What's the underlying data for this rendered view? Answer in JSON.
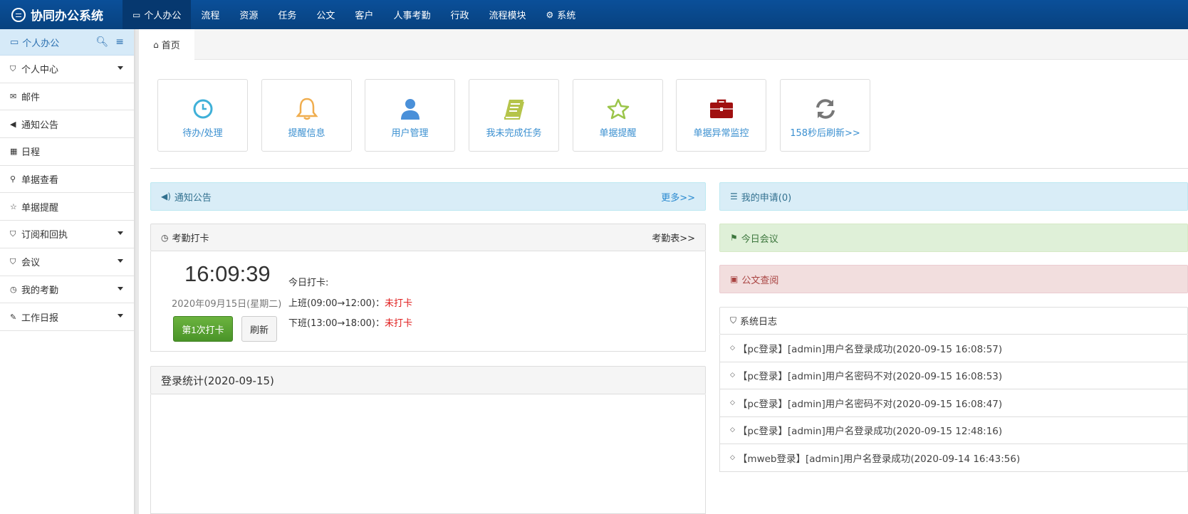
{
  "app": {
    "title": "协同办公系统"
  },
  "nav": [
    {
      "label": "个人办公",
      "icon": "monitor-icon",
      "active": true
    },
    {
      "label": "流程"
    },
    {
      "label": "资源"
    },
    {
      "label": "任务"
    },
    {
      "label": "公文"
    },
    {
      "label": "客户"
    },
    {
      "label": "人事考勤"
    },
    {
      "label": "行政"
    },
    {
      "label": "流程模块"
    },
    {
      "label": "系统",
      "icon": "gear-icon"
    }
  ],
  "sidebar": {
    "title": "个人办公",
    "items": [
      {
        "label": "个人中心",
        "icon": "bookmark-icon",
        "has_children": true
      },
      {
        "label": "邮件",
        "icon": "envelope-icon"
      },
      {
        "label": "通知公告",
        "icon": "volume-icon"
      },
      {
        "label": "日程",
        "icon": "calendar-icon"
      },
      {
        "label": "单据查看",
        "icon": "search-icon"
      },
      {
        "label": "单据提醒",
        "icon": "star-icon"
      },
      {
        "label": "订阅和回执",
        "icon": "bookmark-icon",
        "has_children": true
      },
      {
        "label": "会议",
        "icon": "bookmark-icon",
        "has_children": true
      },
      {
        "label": "我的考勤",
        "icon": "clock-icon",
        "has_children": true
      },
      {
        "label": "工作日报",
        "icon": "edit-icon",
        "has_children": true
      }
    ]
  },
  "tabs": [
    {
      "label": "首页",
      "icon": "home-icon"
    }
  ],
  "tiles": [
    {
      "label": "待办/处理",
      "icon": "clock-icon",
      "color": "#3fb0d8"
    },
    {
      "label": "提醒信息",
      "icon": "bell-icon",
      "color": "#f0ad4e"
    },
    {
      "label": "用户管理",
      "icon": "user-icon",
      "color": "#4a90d9"
    },
    {
      "label": "我未完成任务",
      "icon": "book-icon",
      "color": "#b5c44a"
    },
    {
      "label": "单据提醒",
      "icon": "star-icon",
      "color": "#9bc54a"
    },
    {
      "label": "单据异常监控",
      "icon": "briefcase-icon",
      "color": "#a01010"
    },
    {
      "label": "158秒后刷新>>",
      "icon": "refresh-icon",
      "color": "#777777"
    }
  ],
  "notice_panel": {
    "title": "通知公告",
    "more": "更多>>"
  },
  "attendance_panel": {
    "title": "考勤打卡",
    "more": "考勤表>>",
    "time": "16:09:39",
    "date": "2020年09月15日(星期二)",
    "punch_button": "第1次打卡",
    "refresh_button": "刷新",
    "today_label": "今日打卡:",
    "shifts": [
      {
        "label": "上班(09:00→12:00)：",
        "status": "未打卡"
      },
      {
        "label": "下班(13:00→18:00)：",
        "status": "未打卡"
      }
    ]
  },
  "login_stats_panel": {
    "title": "登录统计(2020-09-15)"
  },
  "my_apply_panel": {
    "title": "我的申请(0)"
  },
  "meeting_panel": {
    "title": "今日会议"
  },
  "doc_panel": {
    "title": "公文查阅"
  },
  "syslog_panel": {
    "title": "系统日志",
    "items": [
      "【pc登录】[admin]用户名登录成功(2020-09-15 16:08:57)",
      "【pc登录】[admin]用户名密码不对(2020-09-15 16:08:53)",
      "【pc登录】[admin]用户名密码不对(2020-09-15 16:08:47)",
      "【pc登录】[admin]用户名登录成功(2020-09-15 12:48:16)",
      "【mweb登录】[admin]用户名登录成功(2020-09-14 16:43:56)"
    ]
  }
}
